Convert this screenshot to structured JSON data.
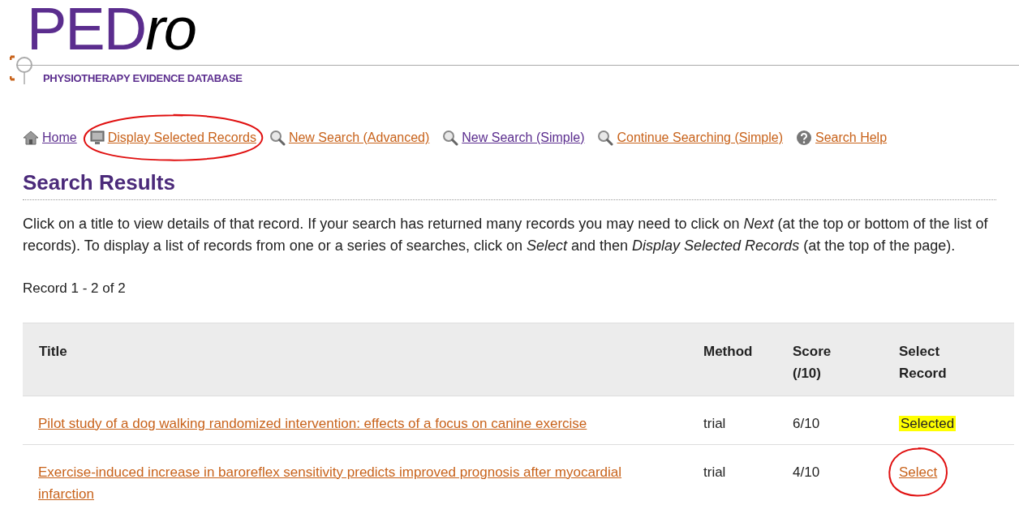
{
  "logo": {
    "letters": "PED",
    "suffix": "ro",
    "tagline": "PHYSIOTHERAPY EVIDENCE DATABASE"
  },
  "nav": [
    {
      "label": "Home",
      "kind": "home",
      "visited": true,
      "circled": false
    },
    {
      "label": "Display Selected Records",
      "kind": "monitor",
      "visited": false,
      "circled": true
    },
    {
      "label": "New Search (Advanced)",
      "kind": "search",
      "visited": false,
      "circled": false
    },
    {
      "label": "New Search (Simple)",
      "kind": "search",
      "visited": true,
      "circled": false
    },
    {
      "label": "Continue Searching (Simple)",
      "kind": "search",
      "visited": false,
      "circled": false
    },
    {
      "label": "Search Help",
      "kind": "help",
      "visited": false,
      "circled": false
    }
  ],
  "heading": "Search Results",
  "intro": "Click on a title to view details of that record. If your search has returned many records you may need to click on *Next* (at the top or bottom of the list of records). To display a list of records from one or a series of searches, click on *Select* and then *Display Selected Records* (at the top of the page).",
  "record_count": "Record 1 - 2 of 2",
  "table": {
    "columns": [
      "Title",
      "Method",
      "Score (/10)",
      "Select Record"
    ],
    "rows": [
      {
        "title": "Pilot study of a dog walking randomized intervention: effects of a focus on canine exercise",
        "method": "trial",
        "score": "6/10",
        "select_label": "Selected",
        "selected": true,
        "circled": false
      },
      {
        "title": "Exercise-induced increase in baroreflex sensitivity predicts improved prognosis after myocardial infarction",
        "method": "trial",
        "score": "4/10",
        "select_label": "Select",
        "selected": false,
        "circled": true
      }
    ]
  }
}
